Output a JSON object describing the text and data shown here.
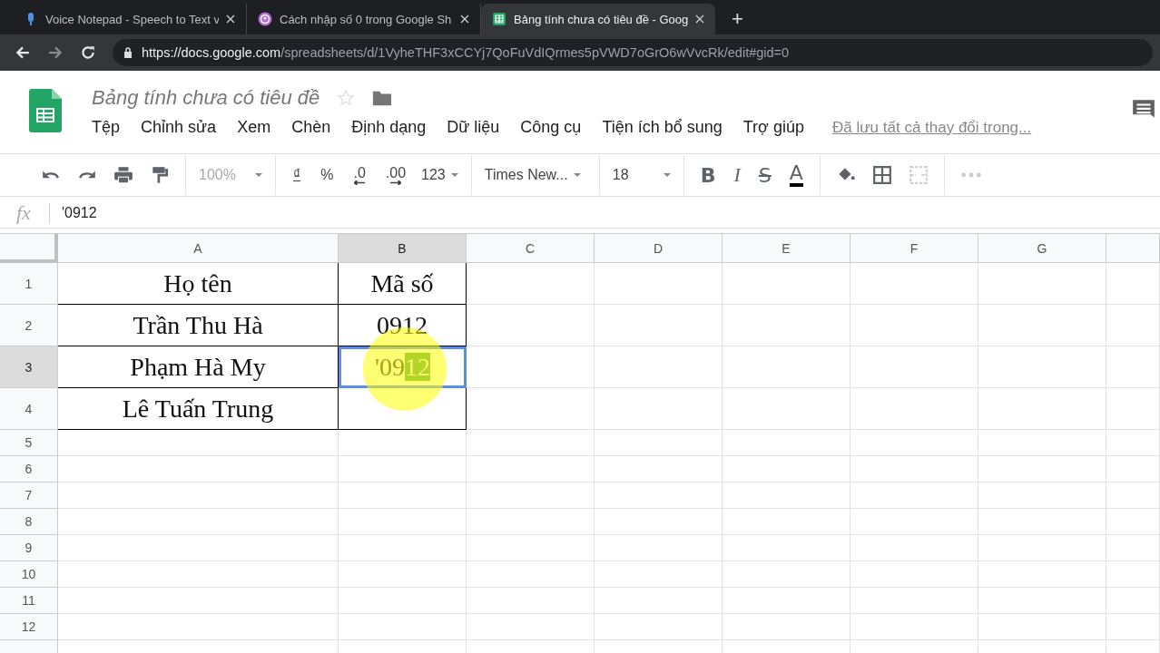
{
  "browser": {
    "tabs": [
      {
        "kind": "mic",
        "title": "Voice Notepad - Speech to Text v",
        "selected": false
      },
      {
        "kind": "podcast",
        "title": "Cách nhập số 0 trong Google Sh",
        "selected": false
      },
      {
        "kind": "sheets",
        "title": "Bảng tính chưa có tiêu đề - Goog",
        "selected": true
      }
    ],
    "new_tab": "+",
    "url": {
      "host": "https://docs.google.com",
      "path": "/spreadsheets/d/1VyheTHF3xCCYj7QoFuVdIQrmes5pVWD7oGrO6wVvcRk/edit#gid=0"
    }
  },
  "doc": {
    "title": "Bảng tính chưa có tiêu đề",
    "menu": [
      "Tệp",
      "Chỉnh sửa",
      "Xem",
      "Chèn",
      "Định dạng",
      "Dữ liệu",
      "Công cụ",
      "Tiện ích bổ sung",
      "Trợ giúp"
    ],
    "save_status": "Đã lưu tất cả thay đổi trong..."
  },
  "toolbar": {
    "zoom": {
      "text": "100%",
      "disabled": true
    },
    "currency": "₫",
    "percent": "%",
    "decrease_decimals": ".0",
    "increase_decimals": ".00",
    "more_formats": "123",
    "font": "Times New...",
    "font_size": "18",
    "bold": "B",
    "italic": "I",
    "strike": "S",
    "text_color": "A",
    "merge_disabled": true
  },
  "formula_bar": {
    "label": "fx",
    "value": "'0912"
  },
  "sheet": {
    "columns": [
      {
        "name": "A",
        "selected": false
      },
      {
        "name": "B",
        "selected": true
      },
      {
        "name": "C",
        "selected": false
      },
      {
        "name": "D",
        "selected": false
      },
      {
        "name": "E",
        "selected": false
      },
      {
        "name": "F",
        "selected": false
      },
      {
        "name": "G",
        "selected": false
      }
    ],
    "rows": [
      {
        "number": "1",
        "selected": false,
        "cells": [
          {
            "text": "Họ tên",
            "bordered": true
          },
          {
            "text": "Mã số",
            "bordered": true
          }
        ]
      },
      {
        "number": "2",
        "selected": false,
        "cells": [
          {
            "text": "Trần Thu Hà",
            "bordered": true
          },
          {
            "text": "0912",
            "bordered": true
          }
        ]
      },
      {
        "number": "3",
        "selected": true,
        "cells": [
          {
            "text": "Phạm Hà My",
            "bordered": true
          },
          {
            "text": "'09",
            "highlighted": "12",
            "editing": true,
            "bordered": true
          }
        ]
      },
      {
        "number": "4",
        "selected": false,
        "cells": [
          {
            "text": "Lê Tuấn Trung",
            "bordered": true
          },
          {
            "bordered": true
          }
        ]
      },
      {
        "number": "5",
        "selected": false
      },
      {
        "number": "6",
        "selected": false
      },
      {
        "number": "7",
        "selected": false
      },
      {
        "number": "8",
        "selected": false
      },
      {
        "number": "9",
        "selected": false
      },
      {
        "number": "10",
        "selected": false
      },
      {
        "number": "11",
        "selected": false
      },
      {
        "number": "12",
        "selected": false
      },
      {
        "selected": false
      }
    ]
  }
}
